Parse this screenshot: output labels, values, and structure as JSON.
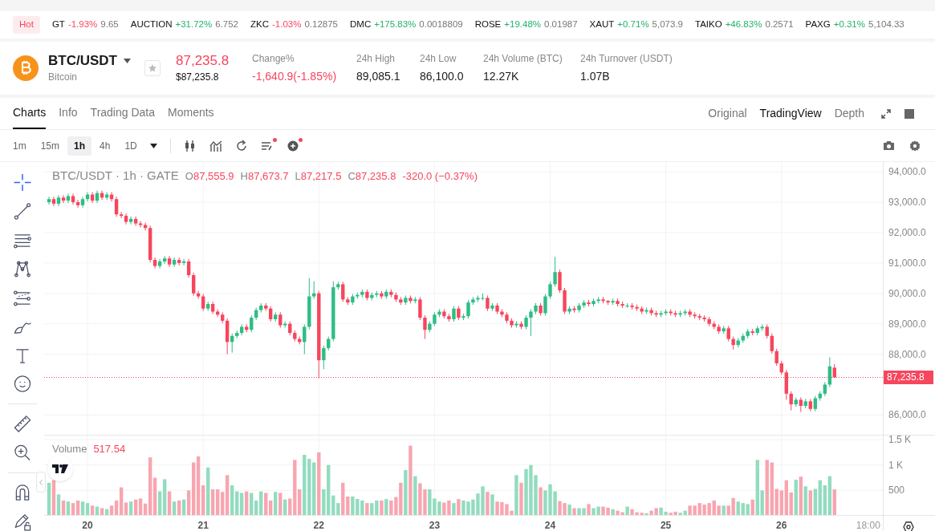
{
  "hot_label": "Hot",
  "ticker": [
    {
      "symbol": "GT",
      "change": "-1.93%",
      "price": "9.65",
      "color": "#f6465d"
    },
    {
      "symbol": "AUCTION",
      "change": "+31.72%",
      "price": "6.752",
      "color": "#20b26c"
    },
    {
      "symbol": "ZKC",
      "change": "-1.03%",
      "price": "0.12875",
      "color": "#f6465d"
    },
    {
      "symbol": "DMC",
      "change": "+175.83%",
      "price": "0.0018809",
      "color": "#20b26c"
    },
    {
      "symbol": "ROSE",
      "change": "+19.48%",
      "price": "0.01987",
      "color": "#20b26c"
    },
    {
      "symbol": "XAUT",
      "change": "+0.71%",
      "price": "5,073.9",
      "color": "#20b26c"
    },
    {
      "symbol": "TAIKO",
      "change": "+46.83%",
      "price": "0.2571",
      "color": "#20b26c"
    },
    {
      "symbol": "PAXG",
      "change": "+0.31%",
      "price": "5,104.33",
      "color": "#20b26c"
    }
  ],
  "pair": {
    "symbol": "BTC/USDT",
    "name": "Bitcoin",
    "price": "87,235.8",
    "price_fiat": "$87,235.8",
    "color": "#f6465d"
  },
  "stats": [
    {
      "label": "Change%",
      "value": "-1,640.9(-1.85%)",
      "color": "#f6465d"
    },
    {
      "label": "24h High",
      "value": "89,085.1"
    },
    {
      "label": "24h Low",
      "value": "86,100.0"
    },
    {
      "label": "24h Volume (BTC)",
      "value": "12.27K"
    },
    {
      "label": "24h Turnover (USDT)",
      "value": "1.07B"
    }
  ],
  "tabs": [
    {
      "label": "Charts",
      "selected": true
    },
    {
      "label": "Info",
      "selected": false
    },
    {
      "label": "Trading Data",
      "selected": false
    },
    {
      "label": "Moments",
      "selected": false
    }
  ],
  "view_tabs": [
    {
      "label": "Original",
      "selected": false
    },
    {
      "label": "TradingView",
      "selected": true
    },
    {
      "label": "Depth",
      "selected": false
    }
  ],
  "intervals": [
    {
      "label": "1m",
      "selected": false
    },
    {
      "label": "15m",
      "selected": false
    },
    {
      "label": "1h",
      "selected": true
    },
    {
      "label": "4h",
      "selected": false
    },
    {
      "label": "1D",
      "selected": false
    }
  ],
  "chart_tools": [
    {
      "kind": "candles",
      "alert": false
    },
    {
      "kind": "indicators",
      "alert": false
    },
    {
      "kind": "replay",
      "alert": false
    },
    {
      "kind": "templates",
      "alert": true
    },
    {
      "kind": "add",
      "alert": true
    }
  ],
  "legend": {
    "title": "BTC/USDT · 1h · GATE",
    "ohlc": [
      {
        "label": "O",
        "value": "87,555.9"
      },
      {
        "label": "H",
        "value": "87,673.7"
      },
      {
        "label": "L",
        "value": "87,217.5"
      },
      {
        "label": "C",
        "value": "87,235.8"
      }
    ],
    "change": "-320.0 (−0.37%)"
  },
  "last_price": "87,235.8",
  "price_chart": {
    "chart_data": {
      "type": "candlestick",
      "xlim": [
        19.625,
        27.327
      ],
      "ylim": [
        85350,
        94320
      ],
      "grid": true,
      "ref_lines": [
        {
          "axis": "y",
          "value": 87235.8
        }
      ],
      "yticks": [
        {
          "value": 94000,
          "label": "94,000.0"
        },
        {
          "value": 93000,
          "label": "93,000.0"
        },
        {
          "value": 92000,
          "label": "92,000.0"
        },
        {
          "value": 91000,
          "label": "91,000.0"
        },
        {
          "value": 90000,
          "label": "90,000.0"
        },
        {
          "value": 89000,
          "label": "89,000.0"
        },
        {
          "value": 88000,
          "label": "88,000.0"
        },
        {
          "value": 86000,
          "label": "86,000.0"
        }
      ],
      "x": [
        19.667,
        19.708,
        19.75,
        19.792,
        19.833,
        19.875,
        19.917,
        19.958,
        20,
        20.042,
        20.083,
        20.125,
        20.167,
        20.208,
        20.25,
        20.292,
        20.333,
        20.375,
        20.417,
        20.458,
        20.5,
        20.542,
        20.583,
        20.625,
        20.667,
        20.708,
        20.75,
        20.792,
        20.833,
        20.875,
        20.917,
        20.958,
        21,
        21.042,
        21.083,
        21.125,
        21.167,
        21.208,
        21.25,
        21.292,
        21.333,
        21.375,
        21.417,
        21.458,
        21.5,
        21.542,
        21.583,
        21.625,
        21.667,
        21.708,
        21.75,
        21.792,
        21.833,
        21.875,
        21.917,
        21.958,
        22,
        22.042,
        22.083,
        22.125,
        22.167,
        22.208,
        22.25,
        22.292,
        22.333,
        22.375,
        22.417,
        22.458,
        22.5,
        22.542,
        22.583,
        22.625,
        22.667,
        22.708,
        22.75,
        22.792,
        22.833,
        22.875,
        22.917,
        22.958,
        23,
        23.042,
        23.083,
        23.125,
        23.167,
        23.208,
        23.25,
        23.292,
        23.333,
        23.375,
        23.417,
        23.458,
        23.5,
        23.542,
        23.583,
        23.625,
        23.667,
        23.708,
        23.75,
        23.792,
        23.833,
        23.875,
        23.917,
        23.958,
        24,
        24.042,
        24.083,
        24.125,
        24.167,
        24.208,
        24.25,
        24.292,
        24.333,
        24.375,
        24.417,
        24.458,
        24.5,
        24.542,
        24.583,
        24.625,
        24.667,
        24.708,
        24.75,
        24.792,
        24.833,
        24.875,
        24.917,
        24.958,
        25,
        25.042,
        25.083,
        25.125,
        25.167,
        25.208,
        25.25,
        25.292,
        25.333,
        25.375,
        25.417,
        25.458,
        25.5,
        25.542,
        25.583,
        25.625,
        25.667,
        25.708,
        25.75,
        25.792,
        25.833,
        25.875,
        25.917,
        25.958,
        26,
        26.042,
        26.083,
        26.125,
        26.167,
        26.208,
        26.25,
        26.292,
        26.333,
        26.375,
        26.417,
        26.458
      ],
      "ohlc": [
        [
          93000,
          93180,
          92920,
          93100
        ],
        [
          93100,
          93180,
          92870,
          92950
        ],
        [
          92950,
          93230,
          92870,
          93150
        ],
        [
          93150,
          93230,
          92970,
          93050
        ],
        [
          93050,
          93280,
          92970,
          93200
        ],
        [
          93200,
          93280,
          92920,
          93000
        ],
        [
          93000,
          93080,
          92820,
          92900
        ],
        [
          92900,
          93180,
          92820,
          93100
        ],
        [
          93100,
          93330,
          93020,
          93250
        ],
        [
          93250,
          93330,
          92970,
          93050
        ],
        [
          93050,
          93380,
          92970,
          93300
        ],
        [
          93300,
          93380,
          93070,
          93150
        ],
        [
          93150,
          93330,
          93070,
          93250
        ],
        [
          93250,
          93330,
          93020,
          93100
        ],
        [
          93100,
          93180,
          92520,
          92600
        ],
        [
          92600,
          92680,
          92470,
          92550
        ],
        [
          92550,
          92630,
          92270,
          92350
        ],
        [
          92350,
          92530,
          92270,
          92450
        ],
        [
          92450,
          92530,
          92220,
          92300
        ],
        [
          92300,
          92380,
          92170,
          92250
        ],
        [
          92250,
          92330,
          92070,
          92150
        ],
        [
          92150,
          92230,
          91020,
          91100
        ],
        [
          91100,
          91180,
          90820,
          90900
        ],
        [
          90900,
          91130,
          90820,
          91050
        ],
        [
          91050,
          91230,
          90970,
          91150
        ],
        [
          91150,
          91230,
          90870,
          90950
        ],
        [
          90950,
          91180,
          90870,
          91100
        ],
        [
          91100,
          91180,
          90920,
          91000
        ],
        [
          91000,
          91130,
          90920,
          91050
        ],
        [
          91050,
          91130,
          90520,
          90600
        ],
        [
          90600,
          90680,
          89920,
          90000
        ],
        [
          90000,
          90080,
          89820,
          89900
        ],
        [
          89900,
          89980,
          89420,
          89500
        ],
        [
          89500,
          89730,
          89420,
          89650
        ],
        [
          89650,
          89730,
          89320,
          89400
        ],
        [
          89400,
          89480,
          89220,
          89300
        ],
        [
          89300,
          89380,
          89020,
          89100
        ],
        [
          89100,
          89180,
          88000,
          88400
        ],
        [
          88400,
          88680,
          88050,
          88600
        ],
        [
          88600,
          88780,
          88520,
          88700
        ],
        [
          88700,
          88980,
          88620,
          88900
        ],
        [
          88900,
          88980,
          88720,
          88800
        ],
        [
          88800,
          89280,
          88720,
          89200
        ],
        [
          89200,
          89530,
          89120,
          89450
        ],
        [
          89450,
          89680,
          89370,
          89600
        ],
        [
          89600,
          89680,
          89420,
          89500
        ],
        [
          89500,
          89580,
          89070,
          89150
        ],
        [
          89150,
          89380,
          89070,
          89300
        ],
        [
          89300,
          89380,
          88870,
          88950
        ],
        [
          88950,
          89080,
          88870,
          89000
        ],
        [
          89000,
          89080,
          88620,
          88700
        ],
        [
          88700,
          88780,
          88420,
          88500
        ],
        [
          88500,
          88580,
          88320,
          88400
        ],
        [
          88400,
          88980,
          88000,
          88900
        ],
        [
          88900,
          90500,
          88820,
          89900
        ],
        [
          89900,
          90400,
          89820,
          90000
        ],
        [
          90000,
          90080,
          87200,
          87800
        ],
        [
          87800,
          88280,
          87500,
          88200
        ],
        [
          88200,
          88580,
          88120,
          88500
        ],
        [
          88500,
          90400,
          88420,
          90200
        ],
        [
          90200,
          90380,
          90120,
          90300
        ],
        [
          90300,
          90380,
          89720,
          89800
        ],
        [
          89800,
          89880,
          89620,
          89700
        ],
        [
          89700,
          89980,
          89620,
          89900
        ],
        [
          89900,
          90030,
          89820,
          89950
        ],
        [
          89950,
          90130,
          89870,
          90050
        ],
        [
          90050,
          90130,
          89770,
          89850
        ],
        [
          89850,
          90030,
          89770,
          89950
        ],
        [
          89950,
          90080,
          89870,
          90000
        ],
        [
          90000,
          90080,
          89820,
          89900
        ],
        [
          89900,
          90130,
          89820,
          90050
        ],
        [
          90050,
          90130,
          89870,
          89950
        ],
        [
          89950,
          90030,
          89720,
          89800
        ],
        [
          89800,
          89880,
          89620,
          89700
        ],
        [
          89700,
          89930,
          89620,
          89850
        ],
        [
          89850,
          89930,
          89670,
          89750
        ],
        [
          89750,
          89880,
          89670,
          89800
        ],
        [
          89800,
          89880,
          89120,
          89200
        ],
        [
          89200,
          89280,
          88500,
          88800
        ],
        [
          88800,
          89080,
          88720,
          89000
        ],
        [
          89000,
          89380,
          88920,
          89300
        ],
        [
          89300,
          89480,
          89220,
          89400
        ],
        [
          89400,
          89480,
          89170,
          89250
        ],
        [
          89250,
          89330,
          89070,
          89150
        ],
        [
          89150,
          89580,
          89070,
          89500
        ],
        [
          89500,
          89580,
          89120,
          89200
        ],
        [
          89200,
          89330,
          89120,
          89250
        ],
        [
          89250,
          89780,
          89170,
          89700
        ],
        [
          89700,
          89880,
          89620,
          89800
        ],
        [
          89800,
          89930,
          89720,
          89850
        ],
        [
          89850,
          90000,
          89770,
          89850
        ],
        [
          89850,
          89930,
          89420,
          89500
        ],
        [
          89500,
          89680,
          89420,
          89600
        ],
        [
          89600,
          89680,
          89320,
          89400
        ],
        [
          89400,
          89480,
          89220,
          89300
        ],
        [
          89300,
          89380,
          89020,
          89100
        ],
        [
          89100,
          89180,
          88870,
          88950
        ],
        [
          88950,
          89080,
          88870,
          89000
        ],
        [
          89000,
          89080,
          88820,
          88900
        ],
        [
          88900,
          89280,
          88820,
          89200
        ],
        [
          89200,
          89480,
          88600,
          89400
        ],
        [
          89400,
          89680,
          89320,
          89600
        ],
        [
          89600,
          89680,
          89270,
          89350
        ],
        [
          89350,
          89980,
          89270,
          89900
        ],
        [
          89900,
          90380,
          89820,
          90300
        ],
        [
          90300,
          91200,
          90220,
          90700
        ],
        [
          90700,
          90780,
          90020,
          90100
        ],
        [
          90100,
          90180,
          89320,
          89400
        ],
        [
          89400,
          89580,
          89320,
          89500
        ],
        [
          89500,
          89580,
          89370,
          89450
        ],
        [
          89450,
          89680,
          89370,
          89600
        ],
        [
          89600,
          89780,
          89520,
          89700
        ],
        [
          89700,
          89780,
          89570,
          89650
        ],
        [
          89650,
          89830,
          89570,
          89750
        ],
        [
          89750,
          89880,
          89670,
          89800
        ],
        [
          89800,
          89880,
          89670,
          89750
        ],
        [
          89750,
          89780,
          89620,
          89700
        ],
        [
          89700,
          89830,
          89620,
          89750
        ],
        [
          89750,
          89830,
          89570,
          89650
        ],
        [
          89650,
          89730,
          89520,
          89600
        ],
        [
          89600,
          89680,
          89520,
          89600
        ],
        [
          89600,
          89680,
          89470,
          89550
        ],
        [
          89550,
          89630,
          89420,
          89500
        ],
        [
          89500,
          89580,
          89320,
          89400
        ],
        [
          89400,
          89530,
          89320,
          89450
        ],
        [
          89450,
          89530,
          89270,
          89350
        ],
        [
          89350,
          89430,
          89220,
          89300
        ],
        [
          89300,
          89430,
          89220,
          89350
        ],
        [
          89350,
          89480,
          89270,
          89400
        ],
        [
          89400,
          89480,
          89270,
          89350
        ],
        [
          89350,
          89430,
          89220,
          89300
        ],
        [
          89300,
          89430,
          89220,
          89350
        ],
        [
          89350,
          89480,
          89270,
          89400
        ],
        [
          89400,
          89480,
          89220,
          89300
        ],
        [
          89300,
          89380,
          89170,
          89250
        ],
        [
          89250,
          89330,
          89120,
          89200
        ],
        [
          89200,
          89280,
          89070,
          89150
        ],
        [
          89150,
          89230,
          88920,
          89000
        ],
        [
          89000,
          89080,
          88820,
          88900
        ],
        [
          88900,
          88980,
          88670,
          88750
        ],
        [
          88750,
          88930,
          88670,
          88850
        ],
        [
          88850,
          88930,
          88420,
          88500
        ],
        [
          88500,
          88580,
          88150,
          88300
        ],
        [
          88300,
          88530,
          88220,
          88450
        ],
        [
          88450,
          88680,
          88370,
          88600
        ],
        [
          88600,
          88830,
          88520,
          88750
        ],
        [
          88750,
          88830,
          88620,
          88700
        ],
        [
          88700,
          88930,
          88620,
          88850
        ],
        [
          88850,
          88980,
          88770,
          88900
        ],
        [
          88900,
          88980,
          88520,
          88600
        ],
        [
          88600,
          88680,
          88020,
          88100
        ],
        [
          88100,
          88180,
          87620,
          87700
        ],
        [
          87700,
          87780,
          87320,
          87400
        ],
        [
          87400,
          87480,
          86500,
          86700
        ],
        [
          86700,
          86780,
          86150,
          86350
        ],
        [
          86350,
          86580,
          86270,
          86500
        ],
        [
          86500,
          86580,
          86100,
          86300
        ],
        [
          86300,
          86530,
          86220,
          86450
        ],
        [
          86450,
          86530,
          86120,
          86200
        ],
        [
          86200,
          86630,
          86120,
          86550
        ],
        [
          86550,
          86780,
          86470,
          86700
        ],
        [
          86700,
          87080,
          86620,
          87000
        ],
        [
          87000,
          87900,
          86920,
          87600
        ],
        [
          87555.9,
          87673.7,
          87217.5,
          87235.8
        ]
      ]
    }
  },
  "volume": {
    "label": "Volume",
    "value": "517.54",
    "time_label": "18:00",
    "chart_data": {
      "type": "bar",
      "xlim": [
        19.625,
        27.327
      ],
      "ylim": [
        0,
        1580
      ],
      "grid": true,
      "xticks": [
        {
          "value": 20,
          "label": "20"
        },
        {
          "value": 21,
          "label": "21"
        },
        {
          "value": 22,
          "label": "22"
        },
        {
          "value": 23,
          "label": "23"
        },
        {
          "value": 24,
          "label": "24"
        },
        {
          "value": 25,
          "label": "25"
        },
        {
          "value": 26,
          "label": "26"
        }
      ],
      "x": [
        19.667,
        19.708,
        19.75,
        19.792,
        19.833,
        19.875,
        19.917,
        19.958,
        20,
        20.042,
        20.083,
        20.125,
        20.167,
        20.208,
        20.25,
        20.292,
        20.333,
        20.375,
        20.417,
        20.458,
        20.5,
        20.542,
        20.583,
        20.625,
        20.667,
        20.708,
        20.75,
        20.792,
        20.833,
        20.875,
        20.917,
        20.958,
        21,
        21.042,
        21.083,
        21.125,
        21.167,
        21.208,
        21.25,
        21.292,
        21.333,
        21.375,
        21.417,
        21.458,
        21.5,
        21.542,
        21.583,
        21.625,
        21.667,
        21.708,
        21.75,
        21.792,
        21.833,
        21.875,
        21.917,
        21.958,
        22,
        22.042,
        22.083,
        22.125,
        22.167,
        22.208,
        22.25,
        22.292,
        22.333,
        22.375,
        22.417,
        22.458,
        22.5,
        22.542,
        22.583,
        22.625,
        22.667,
        22.708,
        22.75,
        22.792,
        22.833,
        22.875,
        22.917,
        22.958,
        23,
        23.042,
        23.083,
        23.125,
        23.167,
        23.208,
        23.25,
        23.292,
        23.333,
        23.375,
        23.417,
        23.458,
        23.5,
        23.542,
        23.583,
        23.625,
        23.667,
        23.708,
        23.75,
        23.792,
        23.833,
        23.875,
        23.917,
        23.958,
        24,
        24.042,
        24.083,
        24.125,
        24.167,
        24.208,
        24.25,
        24.292,
        24.333,
        24.375,
        24.417,
        24.458,
        24.5,
        24.542,
        24.583,
        24.625,
        24.667,
        24.708,
        24.75,
        24.792,
        24.833,
        24.875,
        24.917,
        24.958,
        25,
        25.042,
        25.083,
        25.125,
        25.167,
        25.208,
        25.25,
        25.292,
        25.333,
        25.375,
        25.417,
        25.458,
        25.5,
        25.542,
        25.583,
        25.625,
        25.667,
        25.708,
        25.75,
        25.792,
        25.833,
        25.875,
        25.917,
        25.958,
        26,
        26.042,
        26.083,
        26.125,
        26.167,
        26.208,
        26.25,
        26.292,
        26.333,
        26.375,
        26.417,
        26.458
      ],
      "yticks": [
        {
          "value": 1500,
          "label": "1.5 K"
        },
        {
          "value": 1000,
          "label": "1 K"
        },
        {
          "value": 500,
          "label": "500"
        }
      ],
      "values": [
        650,
        700,
        420,
        300,
        280,
        250,
        300,
        280,
        250,
        200,
        180,
        150,
        130,
        200,
        300,
        560,
        260,
        280,
        320,
        340,
        240,
        1150,
        750,
        480,
        720,
        480,
        280,
        300,
        320,
        500,
        1050,
        1170,
        600,
        950,
        520,
        520,
        470,
        800,
        600,
        480,
        450,
        480,
        450,
        300,
        480,
        450,
        300,
        470,
        450,
        320,
        340,
        1100,
        520,
        1200,
        1120,
        1050,
        1250,
        520,
        1000,
        400,
        250,
        650,
        380,
        380,
        330,
        300,
        250,
        250,
        300,
        300,
        330,
        300,
        370,
        650,
        900,
        1380,
        780,
        640,
        520,
        520,
        340,
        280,
        260,
        300,
        250,
        330,
        300,
        280,
        320,
        440,
        580,
        470,
        420,
        280,
        270,
        230,
        100,
        800,
        650,
        920,
        1000,
        800,
        560,
        500,
        620,
        480,
        290,
        250,
        220,
        150,
        150,
        150,
        230,
        150,
        180,
        180,
        160,
        130,
        100,
        70,
        180,
        130,
        70,
        60,
        50,
        100,
        150,
        160,
        80,
        60,
        80,
        60,
        100,
        200,
        200,
        250,
        220,
        250,
        300,
        200,
        200,
        200,
        350,
        280,
        250,
        230,
        320,
        1100,
        500,
        1100,
        1050,
        530,
        500,
        700,
        460,
        710,
        770,
        580,
        500,
        530,
        700,
        600,
        780,
        520
      ]
    }
  }
}
